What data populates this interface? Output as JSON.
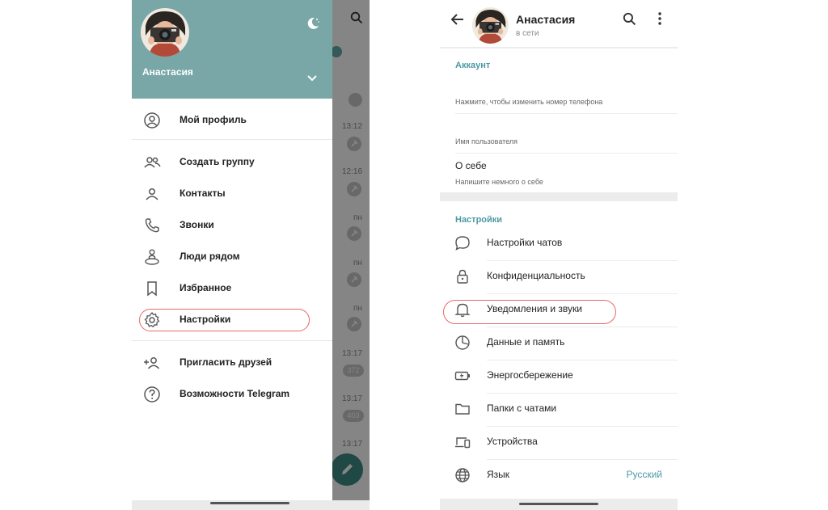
{
  "left": {
    "drawer": {
      "user_name": "Анастасия",
      "items": [
        {
          "label": "Мой профиль",
          "icon": "profile-icon"
        },
        {
          "label": "Создать группу",
          "icon": "group-icon"
        },
        {
          "label": "Контакты",
          "icon": "contact-icon"
        },
        {
          "label": "Звонки",
          "icon": "phone-icon"
        },
        {
          "label": "Люди рядом",
          "icon": "people-nearby-icon"
        },
        {
          "label": "Избранное",
          "icon": "bookmark-icon"
        },
        {
          "label": "Настройки",
          "icon": "gear-icon"
        },
        {
          "label": "Пригласить друзей",
          "icon": "add-user-icon"
        },
        {
          "label": "Возможности Telegram",
          "icon": "question-icon"
        }
      ]
    },
    "chat_list": {
      "times": [
        "13:12",
        "12:16",
        "пн",
        "пн",
        "пн",
        "13:17",
        "13:17",
        "13:17"
      ],
      "counts": [
        "372",
        "403"
      ]
    }
  },
  "right": {
    "header": {
      "name": "Анастасия",
      "status": "в сети"
    },
    "account": {
      "title": "Аккаунт",
      "phone_hint": "Нажмите, чтобы изменить номер телефона",
      "username_label": "Имя пользователя",
      "about_title": "О себе",
      "about_hint": "Напишите немного о себе"
    },
    "settings": {
      "title": "Настройки",
      "items": [
        {
          "label": "Настройки чатов",
          "icon": "chat-bubble-icon"
        },
        {
          "label": "Конфиденциальность",
          "icon": "lock-icon"
        },
        {
          "label": "Уведомления и звуки",
          "icon": "bell-icon"
        },
        {
          "label": "Данные и память",
          "icon": "pie-chart-icon"
        },
        {
          "label": "Энергосбережение",
          "icon": "battery-icon"
        },
        {
          "label": "Папки с чатами",
          "icon": "folder-icon"
        },
        {
          "label": "Устройства",
          "icon": "devices-icon"
        },
        {
          "label": "Язык",
          "icon": "globe-icon",
          "value": "Русский"
        }
      ]
    }
  },
  "colors": {
    "header_teal": "#79a7a8",
    "accent": "#4d9aa4",
    "highlight": "#e36a6a"
  }
}
